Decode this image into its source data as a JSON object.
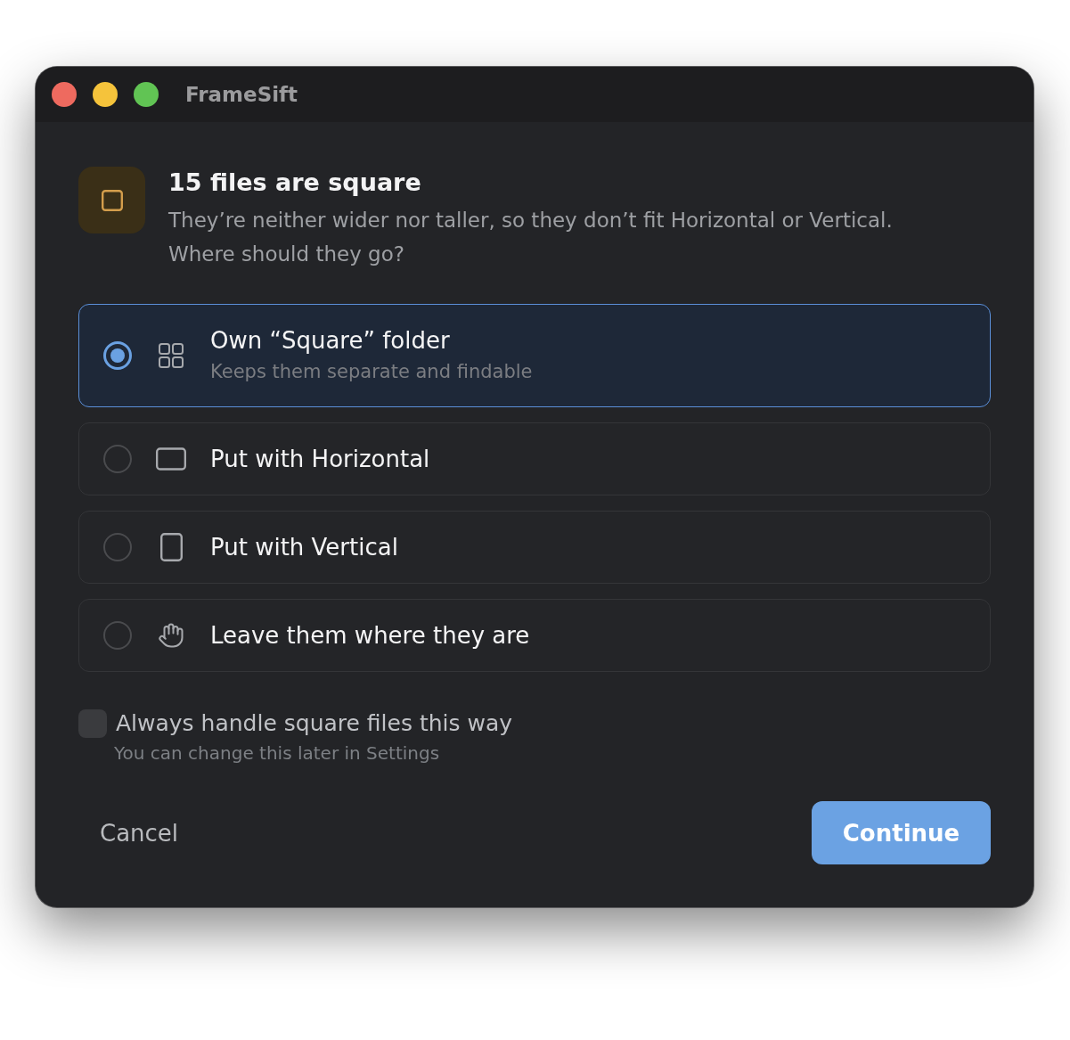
{
  "window": {
    "title": "FrameSift",
    "controls": [
      {
        "kind": "close"
      },
      {
        "kind": "minimize"
      },
      {
        "kind": "zoom"
      }
    ]
  },
  "header": {
    "title": "15 files are square",
    "message": "They’re neither wider nor taller, so they don’t fit Horizontal or Vertical. Where should they go?"
  },
  "options": [
    {
      "kind": "grid",
      "label": "Own “Square” folder",
      "description": "Keeps them separate and findable",
      "selected": true
    },
    {
      "kind": "landscape",
      "label": "Put with Horizontal",
      "selected": false
    },
    {
      "kind": "portrait",
      "label": "Put with Vertical",
      "selected": false
    },
    {
      "kind": "hand",
      "label": "Leave them where they are",
      "selected": false
    }
  ],
  "remember": {
    "label": "Always handle square files this way",
    "hint": "You can change this later in Settings",
    "checked": false
  },
  "actions": [
    {
      "kind": "secondary",
      "label": "Cancel"
    },
    {
      "kind": "primary",
      "label": "Continue"
    }
  ]
}
